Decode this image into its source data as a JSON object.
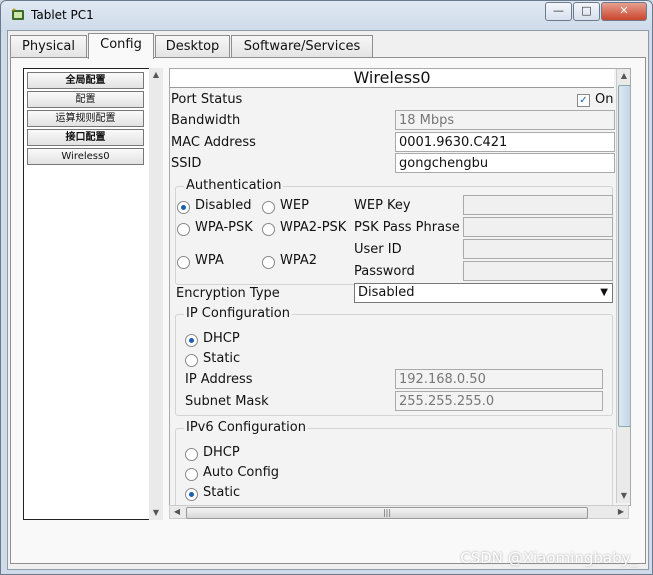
{
  "window": {
    "title": "Tablet PC1",
    "minimize": "—",
    "maximize": "□",
    "close": "✕"
  },
  "tabs": [
    "Physical",
    "Config",
    "Desktop",
    "Software/Services"
  ],
  "sidebar": {
    "items": [
      "全局配置",
      "配置",
      "运算规则配置",
      "接口配置",
      "Wireless0"
    ]
  },
  "panel": {
    "title": "Wireless0",
    "port_status_label": "Port Status",
    "port_status_value": "On",
    "port_status_on": true,
    "bandwidth_label": "Bandwidth",
    "bandwidth_value": "18 Mbps",
    "mac_label": "MAC Address",
    "mac_value": "0001.9630.C421",
    "ssid_label": "SSID",
    "ssid_value": "gongchengbu",
    "auth": {
      "title": "Authentication",
      "options": [
        "Disabled",
        "WEP",
        "WPA-PSK",
        "WPA2-PSK",
        "WPA",
        "WPA2"
      ],
      "selected": "Disabled",
      "wep_key_label": "WEP Key",
      "psk_label": "PSK Pass Phrase",
      "user_id_label": "User ID",
      "password_label": "Password"
    },
    "encryption_label": "Encryption Type",
    "encryption_value": "Disabled",
    "ip": {
      "title": "IP Configuration",
      "dhcp": "DHCP",
      "static": "Static",
      "selected": "DHCP",
      "ip_label": "IP Address",
      "ip_value": "192.168.0.50",
      "mask_label": "Subnet Mask",
      "mask_value": "255.255.255.0"
    },
    "ipv6": {
      "title": "IPv6 Configuration",
      "dhcp": "DHCP",
      "auto": "Auto Config",
      "static": "Static",
      "selected": "Static"
    }
  },
  "watermark": "CSDN @Xiaomingbaby_"
}
